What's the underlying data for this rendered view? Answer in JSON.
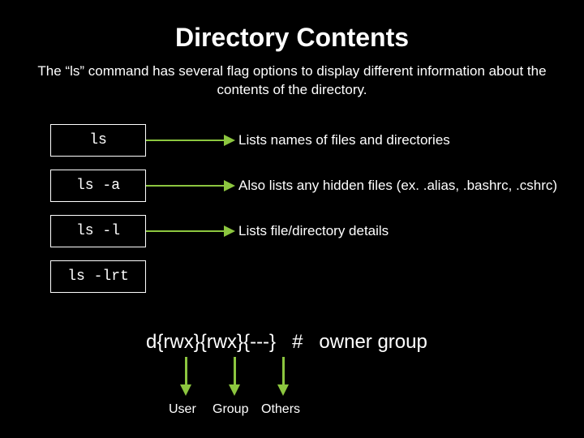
{
  "title": "Directory Contents",
  "subtitle": "The “ls” command has several flag options to display different information about the contents of the directory.",
  "rows": [
    {
      "cmd": "ls",
      "desc": "Lists names of files and directories"
    },
    {
      "cmd": "ls  -a",
      "desc": "Also lists any hidden files (ex. .alias, .bashrc, .cshrc)"
    },
    {
      "cmd": "ls  -l",
      "desc": "Lists file/directory details"
    },
    {
      "cmd": "ls  -lrt",
      "desc": ""
    }
  ],
  "permline": "d{rwx}{rwx}{---}   #   owner group",
  "permlabels": {
    "user": "User",
    "group": "Group",
    "others": "Others"
  }
}
